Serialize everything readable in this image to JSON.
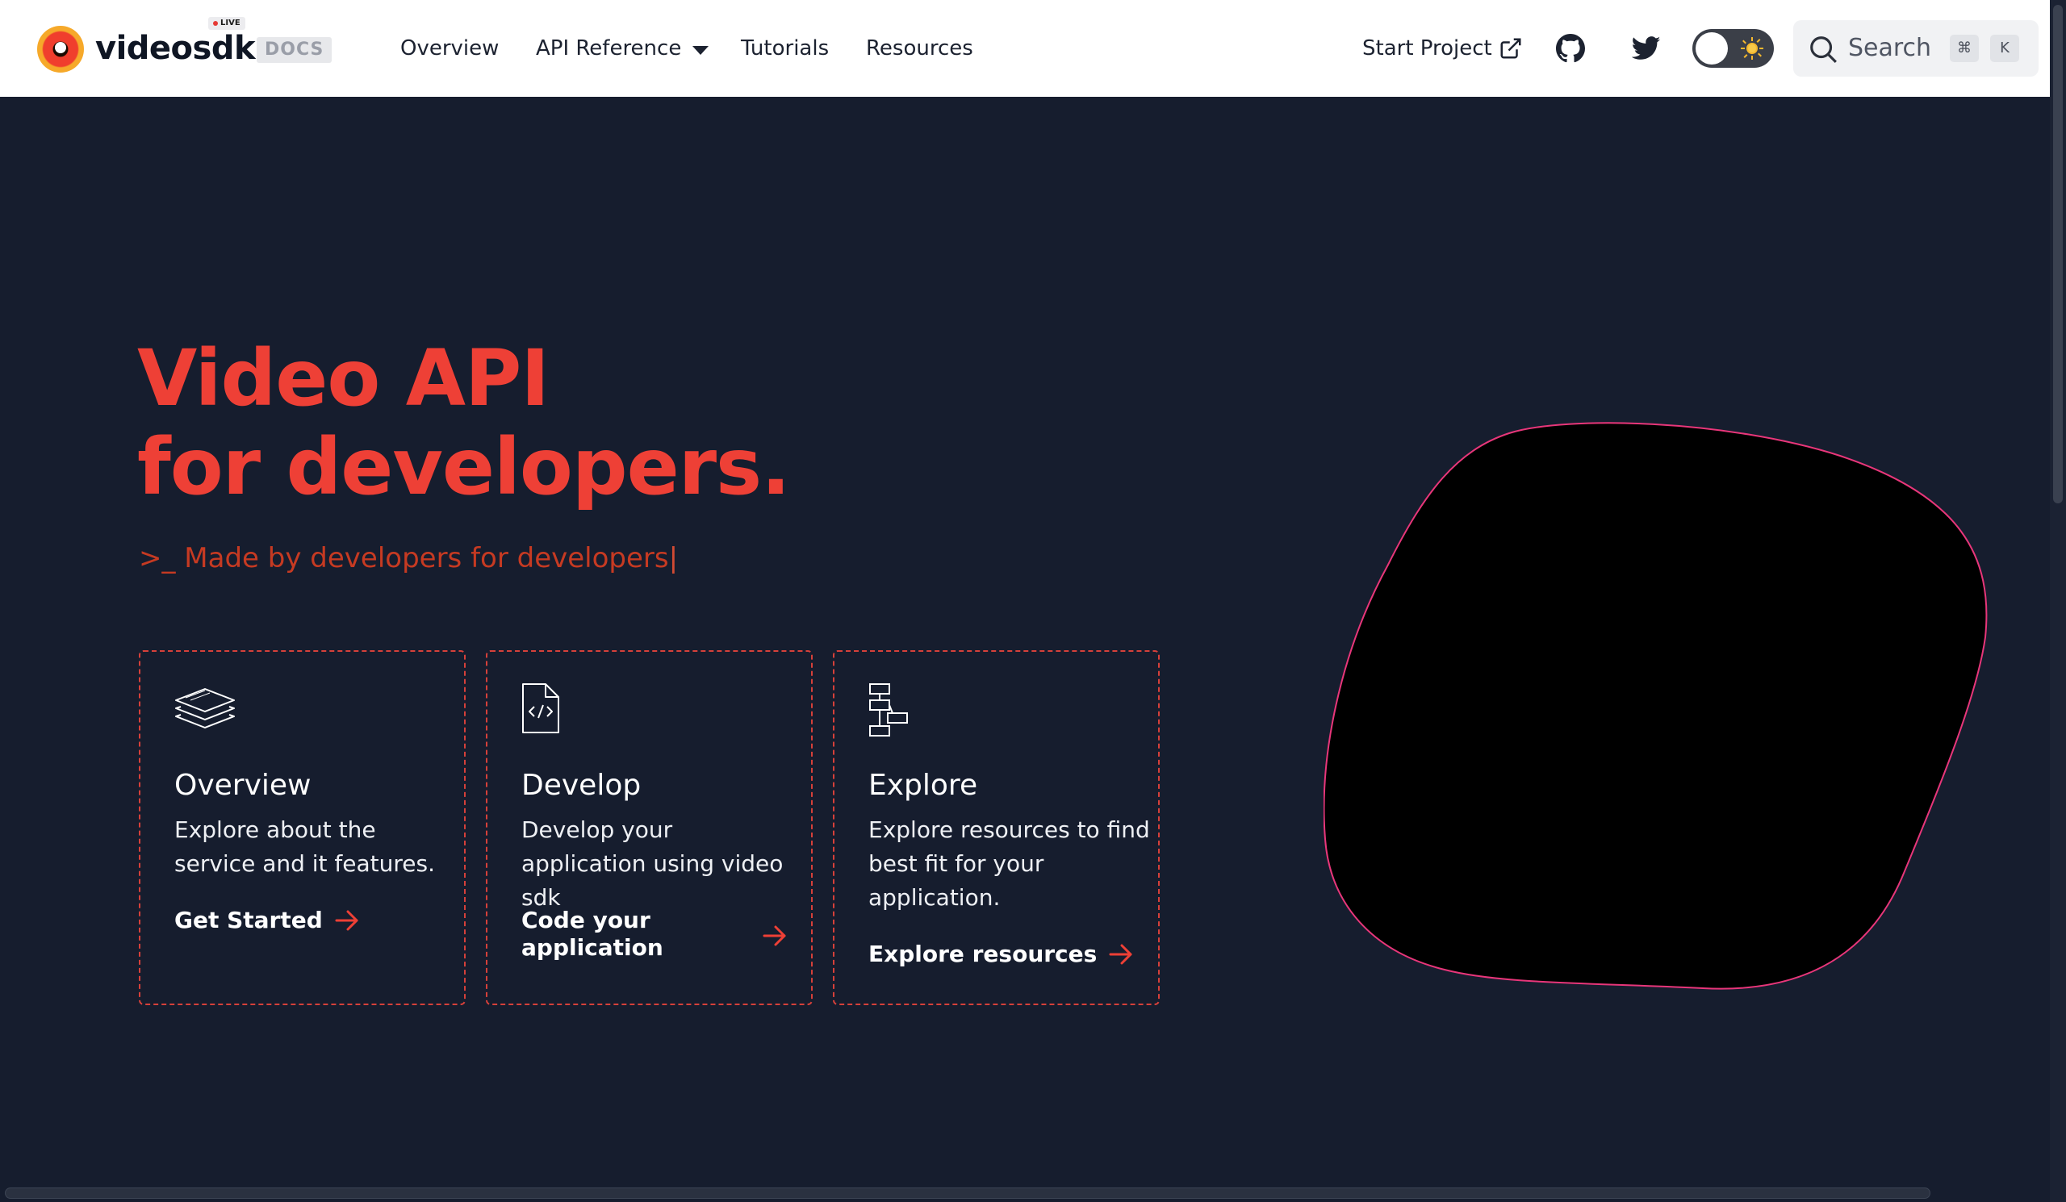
{
  "navbar": {
    "brand": "videosdk",
    "live_badge": "LIVE",
    "docs_badge": "DOCS",
    "links": {
      "overview": "Overview",
      "api_reference": "API Reference",
      "tutorials": "Tutorials",
      "resources": "Resources"
    },
    "start_project": "Start Project",
    "theme_toggle": "dark",
    "search": {
      "label": "Search",
      "shortcut_modifier": "⌘",
      "shortcut_key": "K"
    }
  },
  "hero": {
    "title_line1": "Video API",
    "title_line2": "for developers.",
    "subtitle": ">_ Made by developers for developers",
    "subtitle_cursor": "|",
    "accent_color": "#ee4036"
  },
  "cards": [
    {
      "icon": "layers-icon",
      "title": "Overview",
      "description": "Explore about the service and it features.",
      "cta": "Get Started"
    },
    {
      "icon": "code-file-icon",
      "title": "Develop",
      "description": "Develop your application using video sdk",
      "cta": "Code your application"
    },
    {
      "icon": "sitemap-icon",
      "title": "Explore",
      "description": "Explore resources to find best fit for your application.",
      "cta": "Explore resources"
    }
  ],
  "colors": {
    "background": "#161d2e",
    "navbar": "#ffffff",
    "card_border": "#d6403a",
    "blob_stroke": "#e8367a"
  }
}
